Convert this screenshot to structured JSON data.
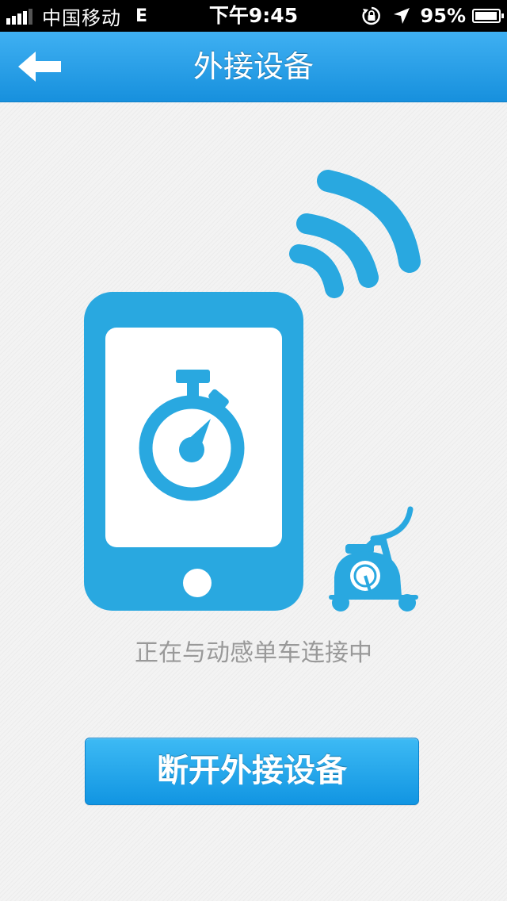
{
  "status_bar": {
    "carrier": "中国移动",
    "network": "E",
    "time": "下午9:45",
    "battery": "95%",
    "battery_level": 0.95
  },
  "nav": {
    "title": "外接设备",
    "back_icon": "back-arrow-icon"
  },
  "illustration": {
    "icons": [
      "wifi-signal-icon",
      "phone-icon",
      "stopwatch-icon",
      "exercise-bike-icon"
    ],
    "accent_color": "#29a8e0"
  },
  "main": {
    "status_text": "正在与动感单车连接中",
    "disconnect_label": "断开外接设备"
  }
}
